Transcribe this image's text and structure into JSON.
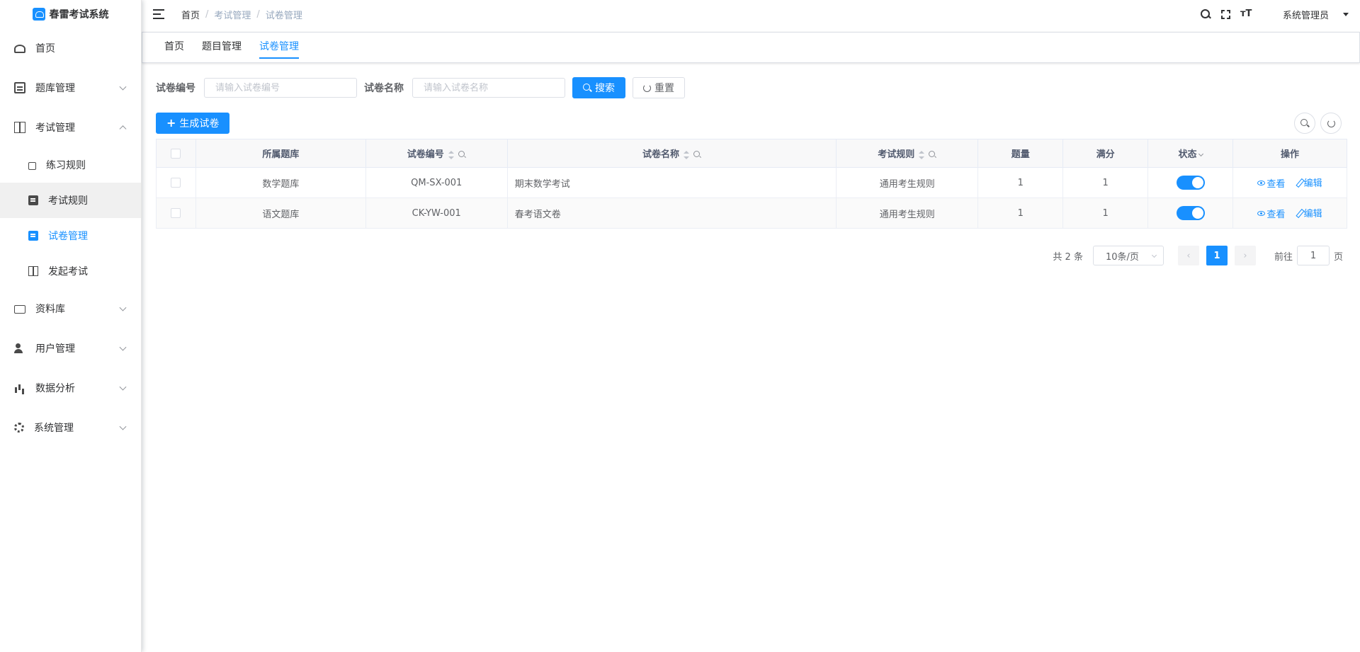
{
  "app": {
    "title": "春雷考试系统"
  },
  "sidebar": {
    "items": [
      {
        "label": "首页"
      },
      {
        "label": "题库管理"
      },
      {
        "label": "考试管理"
      },
      {
        "label": "资料库"
      },
      {
        "label": "用户管理"
      },
      {
        "label": "数据分析"
      },
      {
        "label": "系统管理"
      }
    ],
    "sub_items": [
      {
        "label": "练习规则"
      },
      {
        "label": "考试规则"
      },
      {
        "label": "试卷管理"
      },
      {
        "label": "发起考试"
      }
    ]
  },
  "header": {
    "breadcrumb": [
      "首页",
      "考试管理",
      "试卷管理"
    ],
    "separator": "/",
    "user": "系统管理员"
  },
  "tags": [
    "首页",
    "题目管理",
    "试卷管理"
  ],
  "search": {
    "code_label": "试卷编号",
    "code_placeholder": "请输入试卷编号",
    "name_label": "试卷名称",
    "name_placeholder": "请输入试卷名称",
    "search_button": "搜索",
    "reset_button": "重置"
  },
  "toolbar": {
    "generate_button": "生成试卷"
  },
  "table": {
    "columns": [
      "所属题库",
      "试卷编号",
      "试卷名称",
      "考试规则",
      "题量",
      "满分",
      "状态",
      "操作"
    ],
    "rows": [
      {
        "bank": "数学题库",
        "code": "QM-SX-001",
        "name": "期末数学考试",
        "rule": "通用考生规则",
        "count": "1",
        "score": "1",
        "status": true
      },
      {
        "bank": "语文题库",
        "code": "CK-YW-001",
        "name": "春考语文卷",
        "rule": "通用考生规则",
        "count": "1",
        "score": "1",
        "status": true
      }
    ],
    "actions": {
      "view": "查看",
      "edit": "编辑"
    }
  },
  "pagination": {
    "total_text": "共 2 条",
    "page_size": "10条/页",
    "current_page": "1",
    "goto_label": "前往",
    "goto_value": "1",
    "page_suffix": "页"
  },
  "colors": {
    "primary": "#1890ff"
  },
  "icons": {
    "sidebar": [
      "dashboard-icon",
      "document-icon",
      "book-open-icon",
      "folder-word-icon",
      "users-icon",
      "bar-chart-icon",
      "gear-icon"
    ],
    "sub": [
      "puzzle-icon",
      "file-text-icon",
      "file-text-icon",
      "book-icon"
    ],
    "header": [
      "hamburger-icon",
      "search-icon",
      "fullscreen-icon",
      "font-size-icon"
    ]
  }
}
